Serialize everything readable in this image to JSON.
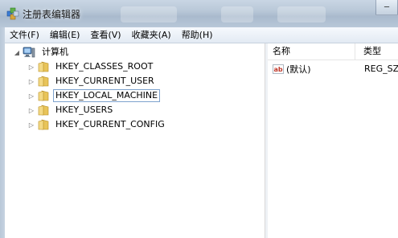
{
  "window": {
    "title": "注册表编辑器"
  },
  "menu": [
    {
      "label": "文件(F)"
    },
    {
      "label": "编辑(E)"
    },
    {
      "label": "查看(V)"
    },
    {
      "label": "收藏夹(A)"
    },
    {
      "label": "帮助(H)"
    }
  ],
  "tree": {
    "root": {
      "label": "计算机",
      "icon": "computer-icon",
      "expanded": true
    },
    "children": [
      {
        "label": "HKEY_CLASSES_ROOT",
        "icon": "folder-icon",
        "selected": false
      },
      {
        "label": "HKEY_CURRENT_USER",
        "icon": "folder-icon",
        "selected": false
      },
      {
        "label": "HKEY_LOCAL_MACHINE",
        "icon": "folder-icon",
        "selected": true
      },
      {
        "label": "HKEY_USERS",
        "icon": "folder-icon",
        "selected": false
      },
      {
        "label": "HKEY_CURRENT_CONFIG",
        "icon": "folder-icon",
        "selected": false
      }
    ]
  },
  "list": {
    "columns": [
      {
        "label": "名称"
      },
      {
        "label": "类型"
      }
    ],
    "rows": [
      {
        "name": "(默认)",
        "type": "REG_SZ",
        "icon": "string-value-icon"
      }
    ]
  },
  "colors": {
    "selection_border": "#7da2ce",
    "folder": "#e8c45a",
    "close_button": "#c7463a"
  }
}
